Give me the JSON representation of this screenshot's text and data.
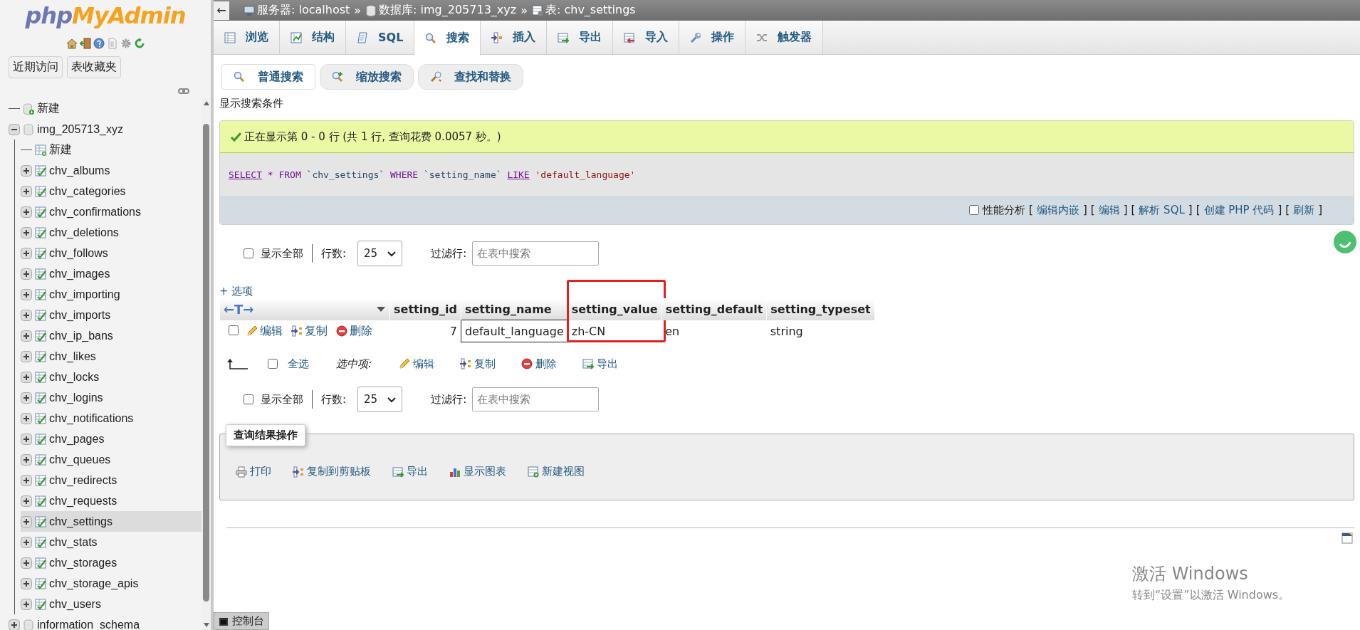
{
  "sidebar": {
    "logo": [
      "php",
      "MyAdmin"
    ],
    "buttons": [
      "近期访问",
      "表收藏夹"
    ],
    "tree": [
      {
        "label": "新建",
        "kind": "new"
      },
      {
        "label": "img_205713_xyz",
        "kind": "database",
        "expanded": true,
        "children": [
          {
            "label": "新建",
            "kind": "new"
          },
          {
            "label": "chv_albums",
            "kind": "table",
            "expanded": false,
            "selected": false
          },
          {
            "label": "chv_categories",
            "kind": "table",
            "expanded": false,
            "selected": false
          },
          {
            "label": "chv_confirmations",
            "kind": "table",
            "expanded": false,
            "selected": false
          },
          {
            "label": "chv_deletions",
            "kind": "table",
            "expanded": false,
            "selected": false
          },
          {
            "label": "chv_follows",
            "kind": "table",
            "expanded": false,
            "selected": false
          },
          {
            "label": "chv_images",
            "kind": "table",
            "expanded": false,
            "selected": false
          },
          {
            "label": "chv_importing",
            "kind": "table",
            "expanded": false,
            "selected": false
          },
          {
            "label": "chv_imports",
            "kind": "table",
            "expanded": false,
            "selected": false
          },
          {
            "label": "chv_ip_bans",
            "kind": "table",
            "expanded": false,
            "selected": false
          },
          {
            "label": "chv_likes",
            "kind": "table",
            "expanded": false,
            "selected": false
          },
          {
            "label": "chv_locks",
            "kind": "table",
            "expanded": false,
            "selected": false
          },
          {
            "label": "chv_logins",
            "kind": "table",
            "expanded": false,
            "selected": false
          },
          {
            "label": "chv_notifications",
            "kind": "table",
            "expanded": false,
            "selected": false
          },
          {
            "label": "chv_pages",
            "kind": "table",
            "expanded": false,
            "selected": false
          },
          {
            "label": "chv_queues",
            "kind": "table",
            "expanded": false,
            "selected": false
          },
          {
            "label": "chv_redirects",
            "kind": "table",
            "expanded": false,
            "selected": false
          },
          {
            "label": "chv_requests",
            "kind": "table",
            "expanded": false,
            "selected": false
          },
          {
            "label": "chv_settings",
            "kind": "table",
            "expanded": false,
            "selected": true
          },
          {
            "label": "chv_stats",
            "kind": "table",
            "expanded": false,
            "selected": false
          },
          {
            "label": "chv_storages",
            "kind": "table",
            "expanded": false,
            "selected": false
          },
          {
            "label": "chv_storage_apis",
            "kind": "table",
            "expanded": false,
            "selected": false
          },
          {
            "label": "chv_users",
            "kind": "table",
            "expanded": false,
            "selected": false
          }
        ]
      },
      {
        "label": "information_schema",
        "kind": "database",
        "expanded": false
      }
    ]
  },
  "breadcrumb": {
    "back": "←",
    "separator": "»",
    "items": [
      "服务器: localhost",
      "数据库: img_205713_xyz",
      "表: chv_settings"
    ]
  },
  "tabs": [
    {
      "label": "浏览",
      "selected": false
    },
    {
      "label": "结构",
      "selected": false
    },
    {
      "label": "SQL",
      "selected": false
    },
    {
      "label": "搜索",
      "selected": true
    },
    {
      "label": "插入",
      "selected": false
    },
    {
      "label": "导出",
      "selected": false
    },
    {
      "label": "导入",
      "selected": false
    },
    {
      "label": "操作",
      "selected": false
    },
    {
      "label": "触发器",
      "selected": false
    }
  ],
  "search_modes": [
    {
      "label": "普通搜索",
      "selected": true
    },
    {
      "label": "缩放搜索",
      "selected": false
    },
    {
      "label": "查找和替换",
      "selected": false
    }
  ],
  "criteria_toggle": "显示搜索条件",
  "result_message": "正在显示第 0 - 0 行 (共 1 行, 查询花费 0.0057 秒。)",
  "sql_query": [
    {
      "kind": "keyword",
      "text": "SELECT"
    },
    {
      "kind": "operator",
      "text": "*"
    },
    {
      "kind": "clause",
      "text": "FROM"
    },
    {
      "kind": "identifier",
      "text": "`chv_settings`"
    },
    {
      "kind": "clause",
      "text": "WHERE"
    },
    {
      "kind": "identifier",
      "text": "`setting_name`"
    },
    {
      "kind": "keyword",
      "text": "LIKE"
    },
    {
      "kind": "string",
      "text": "'default_language'"
    }
  ],
  "query_tools": {
    "profiling": {
      "label": "性能分析",
      "checked": false
    },
    "brackets": [
      "[",
      "]"
    ],
    "links": [
      "编辑内嵌",
      "编辑",
      "解析 SQL",
      "创建 PHP 代码",
      "刷新"
    ]
  },
  "navigation": [
    {
      "show_all": {
        "label": "显示全部",
        "checked": false
      },
      "rows_label": "行数:",
      "rows_value": "25",
      "filter_label": "过滤行:",
      "filter_placeholder": "在表中搜索"
    },
    {
      "show_all": {
        "label": "显示全部",
        "checked": false
      },
      "rows_label": "行数:",
      "rows_value": "25",
      "filter_label": "过滤行:",
      "filter_placeholder": "在表中搜索"
    }
  ],
  "options_link": "+ 选项",
  "table": {
    "column_toggle": "←T→",
    "columns": [
      {
        "name": "setting_id",
        "highlighted": false
      },
      {
        "name": "setting_name",
        "highlighted": false
      },
      {
        "name": "setting_value",
        "highlighted": true
      },
      {
        "name": "setting_default",
        "highlighted": false
      },
      {
        "name": "setting_typeset",
        "highlighted": false
      }
    ],
    "rows": [
      {
        "checked": false,
        "actions": [
          "编辑",
          "复制",
          "删除"
        ],
        "cells": [
          "7",
          "default_language",
          "zh-CN",
          "en",
          "string"
        ]
      }
    ]
  },
  "bulk_actions": {
    "select_all": {
      "label": "全选",
      "checked": false
    },
    "with_selected": "选中项:",
    "actions": [
      "编辑",
      "复制",
      "删除",
      "导出"
    ]
  },
  "result_operations": {
    "legend": "查询结果操作",
    "actions": [
      "打印",
      "复制到剪贴板",
      "导出",
      "显示图表",
      "新建视图"
    ]
  },
  "console": "控制台",
  "os_watermark": {
    "title": "激活 Windows",
    "subtitle": "转到“设置”以激活 Windows。"
  }
}
